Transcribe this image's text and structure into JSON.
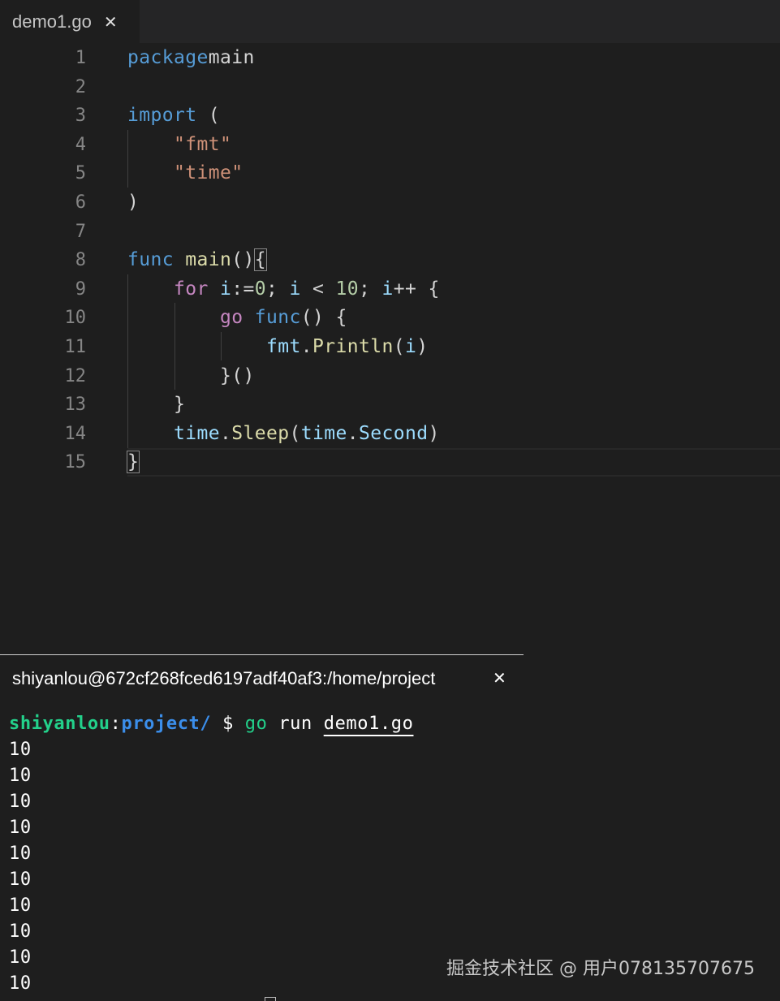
{
  "editor": {
    "tab": {
      "title": "demo1.go",
      "close": "✕"
    },
    "lines": [
      {
        "n": "1",
        "code": [
          [
            "kw",
            "package"
          ],
          [
            "",
            "main"
          ]
        ]
      },
      {
        "n": "2",
        "code": []
      },
      {
        "n": "3",
        "code": [
          [
            "kw",
            "import"
          ],
          [
            "",
            " ("
          ]
        ]
      },
      {
        "n": "4",
        "code": [
          [
            "",
            "    "
          ],
          [
            "str",
            "\"fmt\""
          ]
        ]
      },
      {
        "n": "5",
        "code": [
          [
            "",
            "    "
          ],
          [
            "str",
            "\"time\""
          ]
        ]
      },
      {
        "n": "6",
        "code": [
          [
            "",
            ")"
          ]
        ]
      },
      {
        "n": "7",
        "code": []
      },
      {
        "n": "8",
        "code": [
          [
            "kw",
            "func"
          ],
          [
            "",
            " "
          ],
          [
            "fn",
            "main"
          ],
          [
            "",
            "()"
          ],
          [
            "bm",
            "{"
          ]
        ]
      },
      {
        "n": "9",
        "code": [
          [
            "",
            "    "
          ],
          [
            "ctl",
            "for"
          ],
          [
            "",
            " "
          ],
          [
            "var",
            "i"
          ],
          [
            "",
            ":="
          ],
          [
            "num",
            "0"
          ],
          [
            "",
            "; "
          ],
          [
            "var",
            "i"
          ],
          [
            "",
            " < "
          ],
          [
            "num",
            "10"
          ],
          [
            "",
            "; "
          ],
          [
            "var",
            "i"
          ],
          [
            "",
            "++ {"
          ]
        ]
      },
      {
        "n": "10",
        "code": [
          [
            "",
            "        "
          ],
          [
            "ctl",
            "go"
          ],
          [
            "",
            " "
          ],
          [
            "kw",
            "func"
          ],
          [
            "",
            "() {"
          ]
        ]
      },
      {
        "n": "11",
        "code": [
          [
            "",
            "            "
          ],
          [
            "var",
            "fmt"
          ],
          [
            "",
            "."
          ],
          [
            "fn",
            "Println"
          ],
          [
            "",
            "("
          ],
          [
            "var",
            "i"
          ],
          [
            "",
            ")"
          ]
        ]
      },
      {
        "n": "12",
        "code": [
          [
            "",
            "        "
          ],
          [
            "",
            "}()"
          ]
        ]
      },
      {
        "n": "13",
        "code": [
          [
            "",
            "    "
          ],
          [
            "",
            "}"
          ]
        ]
      },
      {
        "n": "14",
        "code": [
          [
            "",
            "    "
          ],
          [
            "var",
            "time"
          ],
          [
            "",
            "."
          ],
          [
            "fn",
            "Sleep"
          ],
          [
            "",
            "("
          ],
          [
            "var",
            "time"
          ],
          [
            "",
            "."
          ],
          [
            "var",
            "Second"
          ],
          [
            "",
            ")"
          ]
        ]
      },
      {
        "n": "15",
        "code": [
          [
            "bm",
            "}"
          ]
        ]
      }
    ]
  },
  "terminal": {
    "title": "shiyanlou@672cf268fced6197adf40af3:/home/project",
    "close": "✕",
    "prompt": {
      "user": "shiyanlou",
      "colon": ":",
      "path": "project/",
      "symbol": " $ ",
      "cmd_go": "go",
      "cmd_run": " run ",
      "cmd_file": "demo1.go"
    },
    "output": [
      "10",
      "10",
      "10",
      "10",
      "10",
      "10",
      "10",
      "10",
      "10",
      "10"
    ]
  },
  "watermark": "掘金技术社区 @ 用户078135707675",
  "colors": {
    "keyword": "#569cd6",
    "control": "#c586c0",
    "string": "#ce9178",
    "function": "#dcdcaa",
    "number": "#b5cea8",
    "variable": "#9cdcfe",
    "prompt_user": "#23d18b",
    "prompt_path": "#3b8eea"
  }
}
